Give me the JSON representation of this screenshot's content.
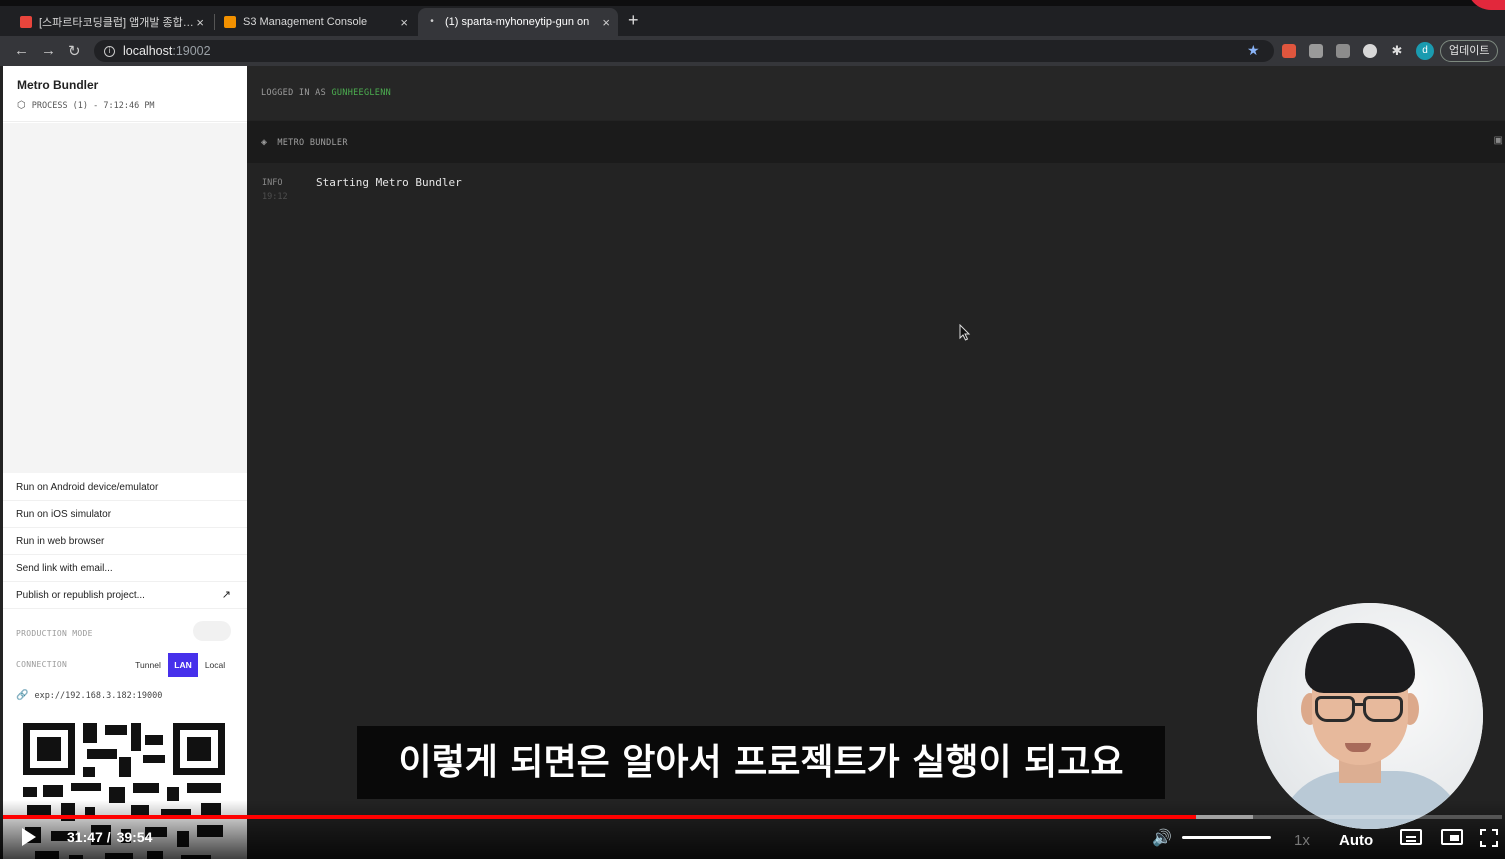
{
  "browser": {
    "tabs": [
      {
        "title": "[스파르타코딩클럽] 앱개발 종합반 -",
        "favicon_color": "#e8453c"
      },
      {
        "title": "S3 Management Console",
        "favicon_color": "#f29100"
      },
      {
        "title": "(1) sparta-myhoneytip-gun on",
        "favicon_color": "#cfcfcf",
        "active": true
      }
    ],
    "close_glyph": "×",
    "new_tab_glyph": "+",
    "url_host": "localhost",
    "url_port": ":19002",
    "update_label": "업데이트",
    "profile_initial": "d"
  },
  "sidebar": {
    "title": "Metro Bundler",
    "process": "PROCESS (1) - 7:12:46 PM",
    "menu": [
      {
        "label": "Run on Android device/emulator"
      },
      {
        "label": "Run on iOS simulator"
      },
      {
        "label": "Run in web browser"
      },
      {
        "label": "Send link with email..."
      },
      {
        "label": "Publish or republish project...",
        "icon": "external-arrow-icon"
      }
    ],
    "production_mode_label": "PRODUCTION MODE",
    "production_mode_on": false,
    "connection_label": "CONNECTION",
    "connection_options": [
      "Tunnel",
      "LAN",
      "Local"
    ],
    "connection_selected": "LAN",
    "exp_url": "exp://192.168.3.182:19000"
  },
  "main": {
    "logged_in_prefix": "LOGGED IN AS ",
    "username": "GUNHEEGLENN",
    "section_title": "METRO BUNDLER",
    "logs": [
      {
        "level": "INFO",
        "time": "19:12",
        "message": "Starting Metro Bundler"
      }
    ]
  },
  "video": {
    "caption": "이렇게 되면은 알아서 프로젝트가 실행이 되고요",
    "current_time": "31:47 /",
    "duration": "39:54",
    "played_fraction": 0.796,
    "buffered_fraction": 0.834,
    "speed": "1x",
    "quality": "Auto",
    "accent_color": "#ff0000"
  }
}
